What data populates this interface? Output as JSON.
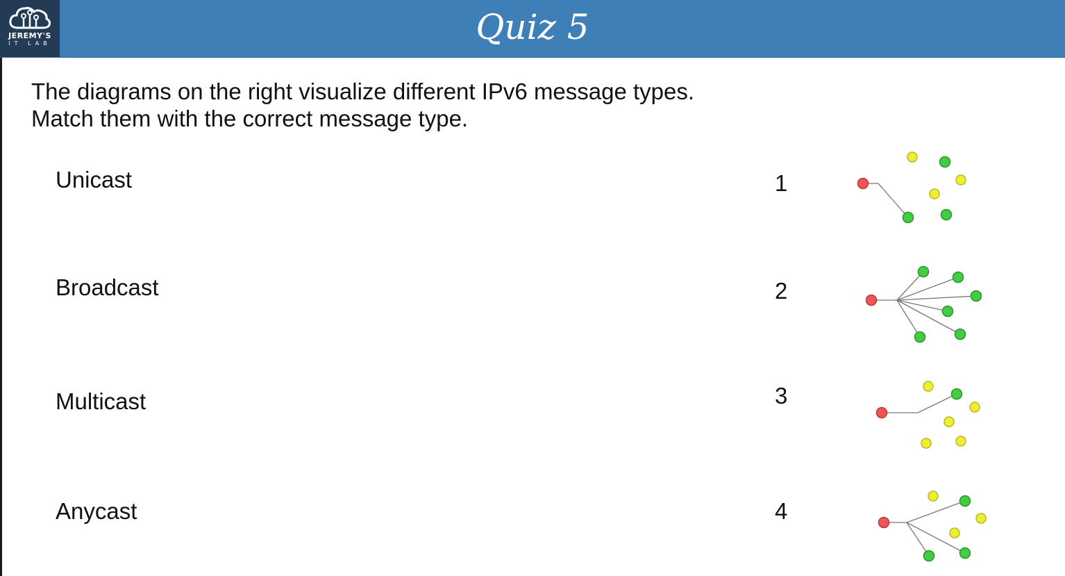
{
  "header": {
    "title": "Quiz 5",
    "logo_text": "JEREMY'S",
    "logo_sub": "IT LAB",
    "logo_icon": "cloud-circuit-icon",
    "background": "#3f7fb8"
  },
  "question": {
    "line1": "The diagrams on the right visualize different IPv6 message types.",
    "line2": "Match them with the correct message type."
  },
  "terms": [
    "Unicast",
    "Broadcast",
    "Multicast",
    "Anycast"
  ],
  "diagram_numbers": [
    "1",
    "2",
    "3",
    "4"
  ],
  "node_colors": {
    "source": "#ee5555",
    "receiver": "#44cc44",
    "non_receiver": "#eeee33"
  }
}
